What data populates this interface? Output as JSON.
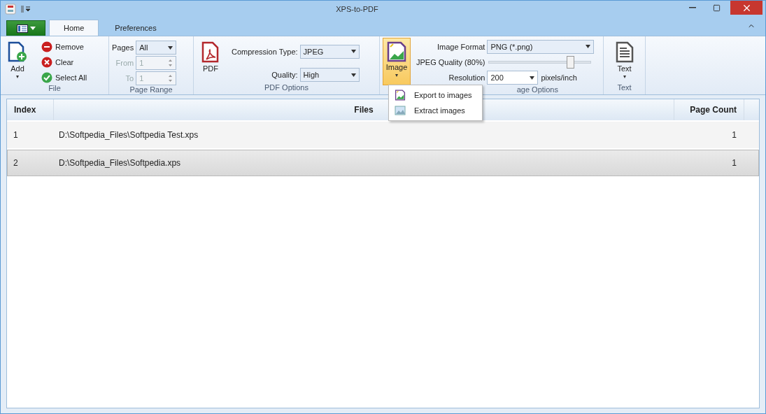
{
  "window": {
    "title": "XPS-to-PDF"
  },
  "tabs": [
    {
      "label": "Home",
      "selected": true
    },
    {
      "label": "Preferences",
      "selected": false
    }
  ],
  "ribbon": {
    "file": {
      "label": "File",
      "add": {
        "label": "Add",
        "caret": "▾"
      },
      "actions": [
        {
          "kind": "remove",
          "label": "Remove"
        },
        {
          "kind": "clear",
          "label": "Clear"
        },
        {
          "kind": "select",
          "label": "Select All"
        }
      ]
    },
    "page_range": {
      "label": "Page Range",
      "pages": {
        "label": "Pages",
        "value": "All"
      },
      "from": {
        "label": "From",
        "value": "1",
        "disabled": true
      },
      "to": {
        "label": "To",
        "value": "1",
        "disabled": true
      }
    },
    "pdf_options": {
      "label": "PDF Options",
      "pdf_button": {
        "label": "PDF"
      },
      "compression": {
        "label": "Compression Type:",
        "value": "JPEG"
      },
      "quality": {
        "label": "Quality:",
        "value": "High"
      }
    },
    "image_options": {
      "label": "age Options",
      "image_button": {
        "label": "Image",
        "caret": "▾",
        "selected": true
      },
      "format": {
        "label": "Image Format",
        "value": "PNG (*.png)"
      },
      "jpeg_quality": {
        "label": "JPEG Quality (80%)",
        "level": 0.8
      },
      "resolution": {
        "label": "Resolution",
        "value": "200",
        "unit": "pixels/inch"
      }
    },
    "text": {
      "label": "Text",
      "text_button": {
        "label": "Text",
        "caret": "▾"
      }
    }
  },
  "image_menu": [
    {
      "kind": "export",
      "label": "Export to images"
    },
    {
      "kind": "extract",
      "label": "Extract images"
    }
  ],
  "table": {
    "columns": [
      "Index",
      "Files",
      "Page Count"
    ],
    "rows": [
      {
        "index": "1",
        "file": "D:\\Softpedia_Files\\Softpedia Test.xps",
        "pages": "1",
        "selected": false
      },
      {
        "index": "2",
        "file": "D:\\Softpedia_Files\\Softpedia.xps",
        "pages": "1",
        "selected": true
      }
    ]
  }
}
